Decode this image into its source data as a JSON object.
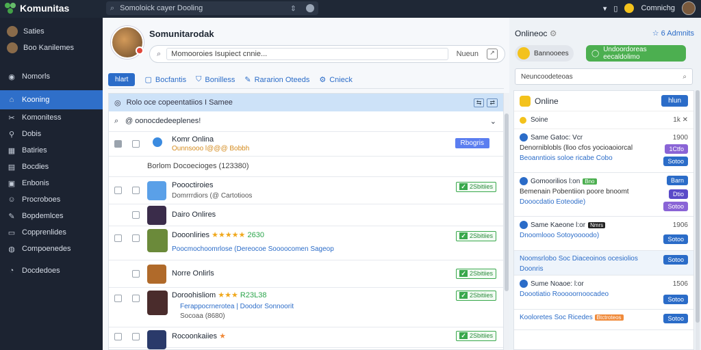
{
  "topbar": {
    "app_name": "Komunitas",
    "search_placeholder": "Somoloick cayer Dooling",
    "user_name": "Comnichg"
  },
  "sidebar": {
    "items": [
      {
        "label": "Saties",
        "icon": "avatar"
      },
      {
        "label": "Boo Kanilemes",
        "icon": "avatar"
      },
      {
        "label": "Nomorls",
        "icon": "circle-icon"
      },
      {
        "label": "Kooning",
        "icon": "home-icon",
        "active": true
      },
      {
        "label": "Komonitess",
        "icon": "tools-icon"
      },
      {
        "label": "Dobis",
        "icon": "pin-icon"
      },
      {
        "label": "Batiries",
        "icon": "grid-icon"
      },
      {
        "label": "Bocdies",
        "icon": "list-icon"
      },
      {
        "label": "Enbonis",
        "icon": "box-icon"
      },
      {
        "label": "Procroboes",
        "icon": "users-icon"
      },
      {
        "label": "Bopdemlces",
        "icon": "pencil-icon"
      },
      {
        "label": "Copprenlides",
        "icon": "card-icon"
      },
      {
        "label": "Compoenedes",
        "icon": "globe-icon"
      },
      {
        "label": "Docdedoes",
        "icon": "clock-icon"
      }
    ]
  },
  "main": {
    "title": "Somunitarodak",
    "search_value": "Momooroies Isupiect cnnie...",
    "search_label": "Nueun",
    "toolbar": {
      "primary": "hlart",
      "items": [
        "Bocfantis",
        "Bonilless",
        "Rararion Oteeds",
        "Cnieck"
      ]
    },
    "banner_text": "Rolo oce copeentatiios I Samee",
    "group_label": "@ oonocdedeeplenes!",
    "rows": [
      {
        "title": "Komr Onlina",
        "sub": "Ounnsooo l@@@ Bobbh",
        "button": "Rbogris"
      },
      {
        "title": "Borlom Docoecioges (123380)"
      },
      {
        "title": "Poooctiroies",
        "sub": "Domrrrdiors (@ Cartotioos",
        "tag": "2Sbitiies"
      },
      {
        "title": "Dairo Onlires",
        "tag": ""
      },
      {
        "title": "Dooonliries",
        "stars": "★★★★★",
        "num": "2630",
        "sub": "Poocmochoomrlose (Dereocoe Soooocomen Sageop",
        "tag": "2Sbitiies"
      },
      {
        "title": "Norre Onlirls",
        "tag": "2Sbitiies"
      },
      {
        "title": "Doroohisliom",
        "stars": "★★★",
        "num": "R23L38",
        "sub": "Ferappocrnerotea | Doodor Sonnoorit",
        "sub2": "Socoaa (8680)",
        "tag": "2Sbitiies"
      },
      {
        "title": "Rocoonkaiies",
        "stars": "★",
        "tag": "2Sbitiies"
      }
    ]
  },
  "right": {
    "title": "Onlineoc",
    "star_label": "☆ 6 Admnits",
    "pill_label": "Bannooees",
    "green_label": "Undoordoreas eecaldolimo",
    "search": "Neuncoodeteoas",
    "panel_title": "Online",
    "panel_btn": "hlun",
    "sort_label": "Soine",
    "sort_right": "1k ✕",
    "cards": [
      {
        "hd": "Same Gatoc: Vcr",
        "cnt": "1900",
        "l1": "Denorniblobls (lloo cfos yocioaoiorcal",
        "l2": "Beoanntiois soloe ricabe Cobo",
        "b1": "1Ctfo",
        "b2": "Sotoo"
      },
      {
        "hd": "Gomoorilios  l:on",
        "badge": "Bno",
        "l1": "Bemenain Pobentiion poore bnoomt",
        "l2": "Dooocdatio Eoteodie)",
        "b1": "Barn",
        "b2": "Dtio",
        "b3": "Sotoo"
      },
      {
        "hd": "Same Kaeone  l:or",
        "badgeD": "Nmrs",
        "cnt": "1906",
        "l1": "Dnoomlooo Sotoyoooodo)",
        "b1": "Sotoo"
      },
      {
        "hd": "",
        "l1": "Noomsrlobo Soc Diaceoinos ocesiolios",
        "l2": "Doonris",
        "b1": "Sotoo"
      },
      {
        "hd": "Sume Noaoe:  l:or",
        "cnt": "1506",
        "l1": "Doootiatio Rooooornoocadeo",
        "b1": "Sotoo"
      },
      {
        "hd": "",
        "l1": "Kooloretes Soc Ricedes",
        "badgeO": "Btctroteos",
        "b1": "Sotoo"
      }
    ]
  }
}
